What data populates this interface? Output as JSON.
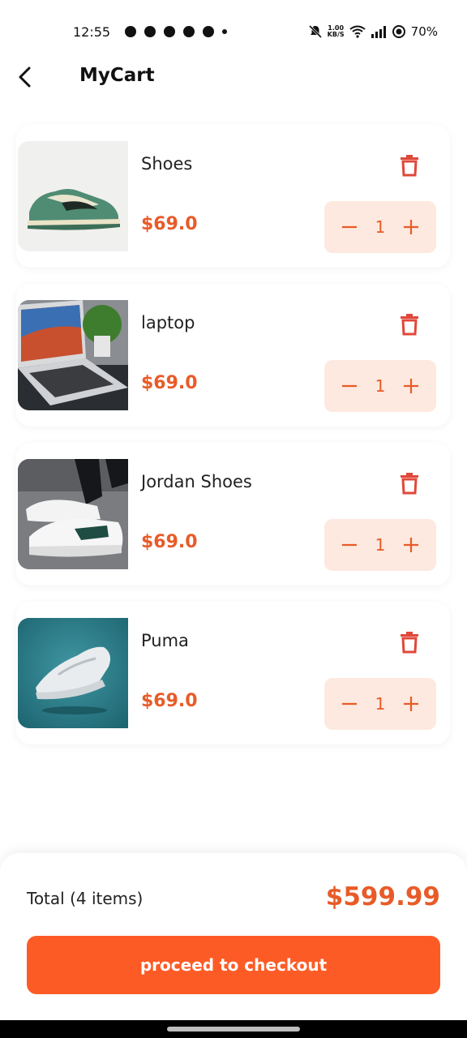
{
  "status_bar": {
    "time": "12:55",
    "speed_top": "1.00",
    "speed_bottom": "KB/S",
    "battery": "70%"
  },
  "header": {
    "title": "MyCart",
    "back_icon": "arrow-back-icon"
  },
  "cart": {
    "items": [
      {
        "name": "Shoes",
        "price": "$69.0",
        "quantity": "1",
        "image": "green-sneaker"
      },
      {
        "name": "laptop",
        "price": "$69.0",
        "quantity": "1",
        "image": "laptop-on-desk"
      },
      {
        "name": " Jordan Shoes",
        "price": "$69.0",
        "quantity": "1",
        "image": "white-sneaker-worn"
      },
      {
        "name": "Puma",
        "price": "$69.0",
        "quantity": "1",
        "image": "white-running-shoe-teal"
      }
    ]
  },
  "summary": {
    "total_label": "Total (4 items)",
    "total_amount": "$599.99",
    "checkout_label": "proceed to checkout"
  },
  "colors": {
    "accent": "#fd5b26",
    "price": "#e85b28",
    "stepper_bg": "#fde9df",
    "delete": "#e0483a"
  }
}
